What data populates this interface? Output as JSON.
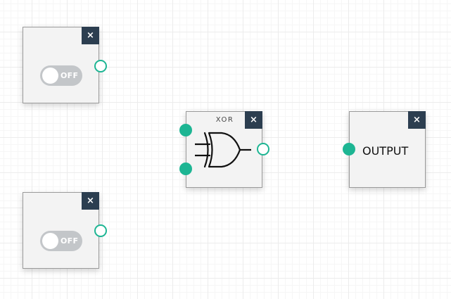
{
  "canvas": {
    "grid": "on"
  },
  "nodes": {
    "switch_a": {
      "type": "toggle-switch",
      "state_label": "OFF",
      "close_label": "×"
    },
    "switch_b": {
      "type": "toggle-switch",
      "state_label": "OFF",
      "close_label": "×"
    },
    "xor_gate": {
      "type": "logic-gate",
      "title": "XOR",
      "inputs": 2,
      "outputs": 1,
      "close_label": "×"
    },
    "output": {
      "type": "output",
      "label": "OUTPUT",
      "inputs": 1,
      "close_label": "×"
    }
  },
  "connections": [],
  "colors": {
    "port": "#1db593",
    "close_button": "#2c3e50",
    "toggle_off": "#c3c6c9",
    "node_background": "#f3f3f3"
  },
  "icons": {
    "close": "close-icon",
    "gate": "xor-gate-icon"
  }
}
